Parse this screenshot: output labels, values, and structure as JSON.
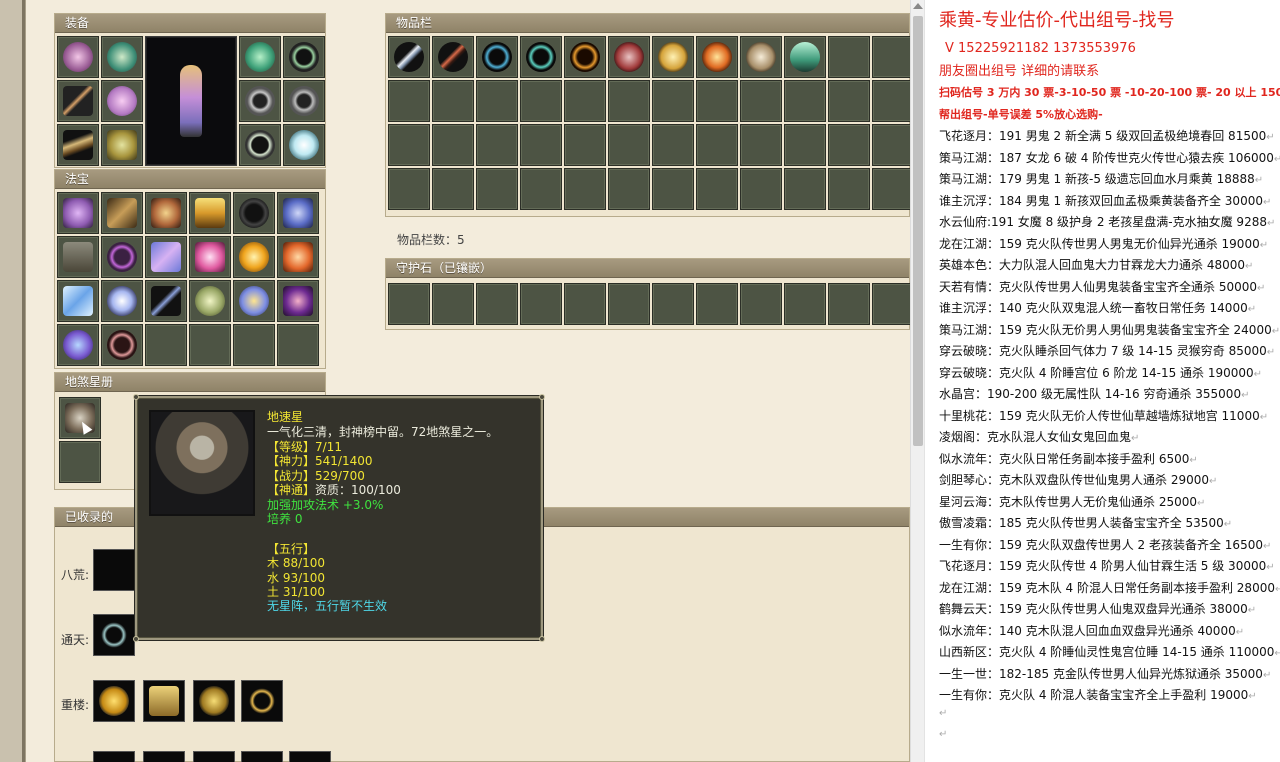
{
  "game": {
    "equip_title": "装备",
    "treasure_title": "法宝",
    "earth_title": "地煞星册",
    "items_title": "物品栏",
    "items_count_label": "物品栏数：5",
    "guard_title": "守护石（已镶嵌）",
    "collected_title": "已收录的",
    "row_labels": [
      "八荒:",
      "通天:",
      "重楼:"
    ]
  },
  "tooltip": {
    "name": "地速星",
    "desc": "一气化三清，封神榜中留。72地煞星之一。",
    "level": "【等级】7/11",
    "shenli": "【神力】541/1400",
    "zhanli": "【战力】529/700",
    "shentong_label": "【神通】",
    "shentong_value": "资质：100/100",
    "bonus": "加强加攻法术 +3.0%",
    "peiyang": "培养 0",
    "wuxing_title": "【五行】",
    "mu": "木 88/100",
    "shui": "水 93/100",
    "tu": "土 31/100",
    "xingzhen": "无星阵，五行暂不生效"
  },
  "doc": {
    "title": "乘黄-专业估价-代出组号-找号",
    "phone": "V 15225921182   1373553976",
    "friends": "朋友圈出组号    详细的请联系",
    "price_rule": "扫码估号 3 万内 30 票-3-10-50 票  -10-20-100 票- 20 以上 150",
    "help_rule": "帮出组号-单号误差 5%放心选购-",
    "listings": [
      "飞花逐月：191 男鬼 2 新全满 5 级双回孟极绝境春回 81500",
      "策马江湖：187 女龙 6 破 4 阶传世克火传世心猿去疾 106000",
      "策马江湖：179 男鬼 1 新孩-5 级遗忘回血水月乘黄 18888",
      "谁主沉浮：184 男鬼 1 新孩双回血孟极乘黄装备齐全 30000",
      "水云仙府:191 女魔 8 级护身 2 老孩星盘满-克水抽女魔 9288",
      "龙在江湖：159 克火队传世男人男鬼无价仙异光通杀 19000",
      "英雄本色：大力队混人回血鬼大力甘霖龙大力通杀 48000",
      "天若有情：克火队传世男人仙男鬼装备宝宝齐全通杀 50000",
      "谁主沉浮：140 克火队双鬼混人统一畜牧日常任务 14000",
      "策马江湖：159 克火队无价男人男仙男鬼装备宝宝齐全 24000",
      "穿云破晓：克火队睡杀回气体力 7 级 14-15 灵猴穷奇 85000",
      "穿云破晓：克火队 4 阶睡宫位 6 阶龙 14-15 通杀 190000",
      "水晶宫：190-200 级无属性队 14-16 穷奇通杀 355000",
      "十里桃花：159 克火队无价人传世仙草越墙炼狱地宫 11000",
      "凌烟阁：克水队混人女仙女鬼回血鬼",
      "似水流年：克火队日常任务副本接手盈利 6500",
      "剑胆琴心：克木队双盘队传世仙鬼男人通杀 29000",
      "星河云海：克木队传世男人无价鬼仙通杀 25000",
      "傲雪凌霜：185 克火队传世男人装备宝宝齐全 53500",
      "一生有你：159 克火队双盘传世男人 2 老孩装备齐全 16500",
      "飞花逐月：159 克火队传世 4 阶男人仙甘霖生活 5 级 30000",
      "龙在江湖：159 克木队 4 阶混人日常任务副本接手盈利 28000",
      "鹤舞云天：159 克火队传世男人仙鬼双盘异光通杀 38000",
      "似水流年：140 克木队混人回血血双盘异光通杀 40000",
      "山西新区：克火队 4 阶睡仙灵性鬼宫位睡 14-15 通杀 110000",
      "一生一世：182-185 克金队传世男人仙异光炼狱通杀 35000",
      "一生有你：克火队 4 阶混人装备宝宝齐全上手盈利 19000"
    ],
    "paragraph_mark": "↵"
  },
  "colors": {
    "panel_title": "#8f8368",
    "doc_red": "#e0261e",
    "tooltip_bg": "#34332b",
    "tooltip_yellow": "#f2e533",
    "tooltip_green": "#3fe33f",
    "tooltip_cyan": "#4fd8e8"
  }
}
